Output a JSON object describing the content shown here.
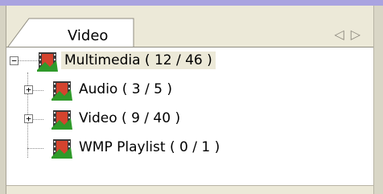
{
  "tab": {
    "label": "Video",
    "prev_icon": "triangle-left",
    "next_icon": "triangle-right"
  },
  "tree": {
    "root": {
      "label": "Multimedia ( 12 / 46 )",
      "expander": "−"
    },
    "children": [
      {
        "label": "Audio ( 3 / 5 )",
        "expander": "+"
      },
      {
        "label": "Video ( 9 / 40 )",
        "expander": "+"
      },
      {
        "label": "WMP Playlist ( 0 / 1 )",
        "expander": ""
      }
    ]
  },
  "colors": {
    "top_strip": "#a9a3e0",
    "selected_bg": "#ece9d8",
    "icon_green": "#2f9a2a",
    "icon_red": "#b63a2a"
  }
}
